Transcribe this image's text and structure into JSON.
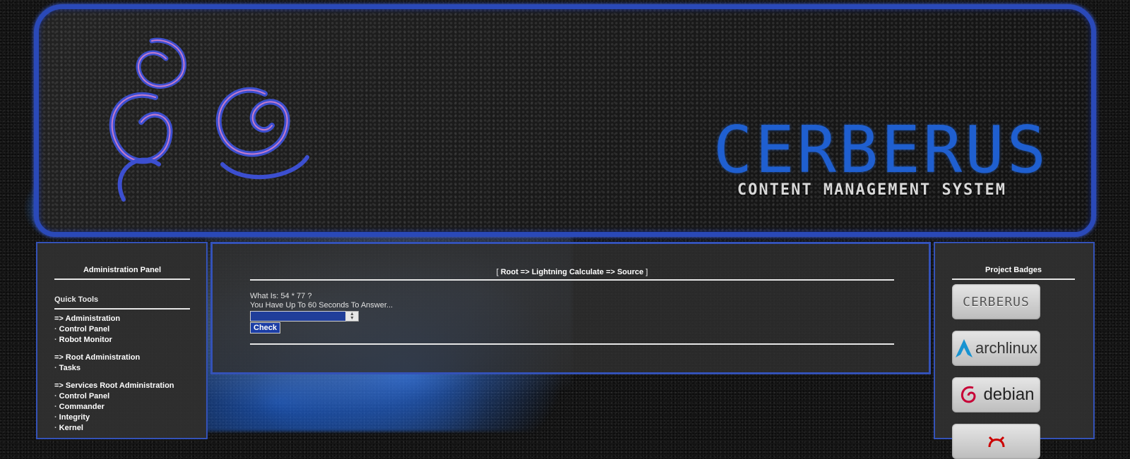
{
  "banner": {
    "title": "CERBERUS",
    "subtitle": "CONTENT MANAGEMENT SYSTEM"
  },
  "left_panel": {
    "heading": "Administration Panel",
    "quick_tools_heading": "Quick Tools",
    "groups": [
      {
        "label": "=> Administration",
        "items": [
          "Control Panel",
          "Robot Monitor"
        ]
      },
      {
        "label": "=> Root Administration",
        "items": [
          "Tasks"
        ]
      },
      {
        "label": "=> Services Root Administration",
        "items": [
          "Control Panel",
          "Commander",
          "Integrity",
          "Kernel"
        ]
      }
    ]
  },
  "center_panel": {
    "breadcrumb": {
      "open": "[",
      "path": "Root => Lightning Calculate => Source",
      "close": "]"
    },
    "question": "What Is: 54 * 77 ?",
    "timer_text": "You Have Up To 60 Seconds To Answer...",
    "answer_value": "",
    "check_label": "Check"
  },
  "right_panel": {
    "heading": "Project Badges",
    "badges": [
      {
        "label": "CERBERUS",
        "icon": "cerberus-logo"
      },
      {
        "label": "archlinux",
        "icon": "arch-logo"
      },
      {
        "label": "debian",
        "icon": "debian-swirl"
      },
      {
        "label": "",
        "icon": "daemon-logo"
      }
    ]
  },
  "colors": {
    "accent_blue": "#3452b8",
    "banner_title_blue": "#1f5fd0",
    "input_blue": "#203e9a"
  }
}
